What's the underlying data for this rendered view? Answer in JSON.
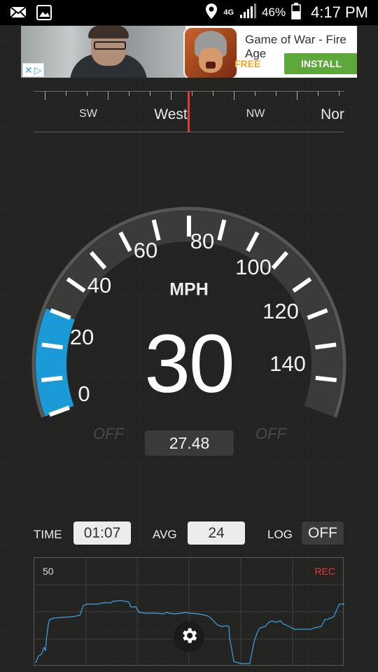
{
  "status_bar": {
    "network": "4G",
    "battery": "46%",
    "time": "4:17 PM"
  },
  "ad": {
    "title": "Game of War - Fire Age",
    "free_label": "FREE",
    "install_label": "INSTALL"
  },
  "compass": {
    "labels": [
      "SW",
      "West",
      "NW",
      "Nor"
    ]
  },
  "gauge": {
    "unit": "MPH",
    "speed": "30",
    "scale": [
      "0",
      "20",
      "40",
      "60",
      "80",
      "100",
      "120",
      "140"
    ],
    "scale_max": 160,
    "current_fraction": 0.1875,
    "off_left": "OFF",
    "off_right": "OFF",
    "odometer": "27.48",
    "colors": {
      "arc_fill": "#1a9bd7",
      "ticks": "#ffffff"
    }
  },
  "stats": {
    "time_label": "TIME",
    "time_value": "01:07",
    "avg_label": "AVG",
    "avg_value": "24",
    "log_label": "LOG",
    "log_value": "OFF"
  },
  "graph": {
    "max_label": "50",
    "rec_label": "REC",
    "line_color": "#3ba6e0"
  }
}
